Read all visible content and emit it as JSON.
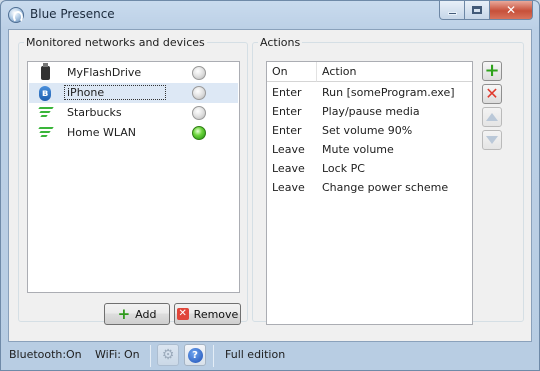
{
  "window": {
    "title": "Blue Presence",
    "icon": "blue-presence-app-icon",
    "controls": {
      "minimize": "minimize-icon",
      "maximize": "maximize-icon",
      "close": "✕"
    }
  },
  "devices_panel": {
    "title": "Monitored networks and devices",
    "devices": [
      {
        "name": "MyFlashDrive",
        "icon": "usb-drive-icon",
        "status": "inactive"
      },
      {
        "name": "iPhone",
        "icon": "bluetooth-icon",
        "status": "inactive",
        "selected": true
      },
      {
        "name": "Starbucks",
        "icon": "wifi-icon",
        "status": "inactive"
      },
      {
        "name": "Home WLAN",
        "icon": "wifi-icon",
        "status": "active"
      }
    ],
    "add_button": "Add",
    "remove_button": "Remove"
  },
  "actions_panel": {
    "title": "Actions",
    "columns": [
      "On",
      "Action"
    ],
    "rows": [
      {
        "on": "Enter",
        "action": "Run [someProgram.exe]"
      },
      {
        "on": "Enter",
        "action": "Play/pause media"
      },
      {
        "on": "Enter",
        "action": "Set volume 90%"
      },
      {
        "on": "Leave",
        "action": "Mute volume"
      },
      {
        "on": "Leave",
        "action": "Lock PC"
      },
      {
        "on": "Leave",
        "action": "Change power scheme"
      }
    ],
    "side_buttons": [
      "add-action-icon",
      "remove-action-icon",
      "move-up-icon",
      "move-down-icon"
    ]
  },
  "statusbar": {
    "bluetooth_label": "Bluetooth:",
    "bluetooth_value": "On",
    "wifi_label": "WiFi:",
    "wifi_value": "On",
    "edition": "Full edition"
  },
  "colors": {
    "status_active": "#3cc222",
    "status_inactive": "#d4d4d4",
    "selection": "#dde8f5",
    "wifi": "#3ab53a",
    "bluetooth": "#2f74c8"
  }
}
